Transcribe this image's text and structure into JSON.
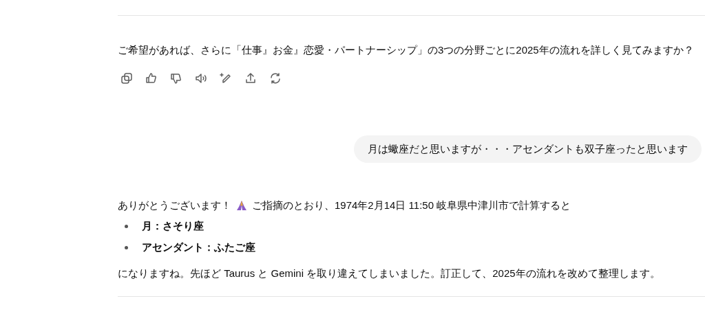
{
  "assistant_message_1": {
    "text": "ご希望があれば、さらに「仕事』お金』恋愛・パートナーシップ」の3つの分野ごとに2025年の流れを詳しく見てみますか？",
    "actions": [
      {
        "kind": "copy"
      },
      {
        "kind": "like"
      },
      {
        "kind": "dislike"
      },
      {
        "kind": "speak"
      },
      {
        "kind": "edit"
      },
      {
        "kind": "share"
      },
      {
        "kind": "regenerate"
      }
    ]
  },
  "user_message": {
    "text": "月は蠍座だと思いますが・・・アセンダントも双子座ったと思います"
  },
  "assistant_message_2": {
    "intro_before": "ありがとうございます！",
    "intro_after": "ご指摘のとおり、1974年2月14日 11:50 岐阜県中津川市で計算すると",
    "bullets": [
      "月：さそり座",
      "アセンダント：ふたご座"
    ],
    "closing": "になりますね。先ほど Taurus と Gemini を取り違えてしまいました。訂正して、2025年の流れを改めて整理します。"
  }
}
